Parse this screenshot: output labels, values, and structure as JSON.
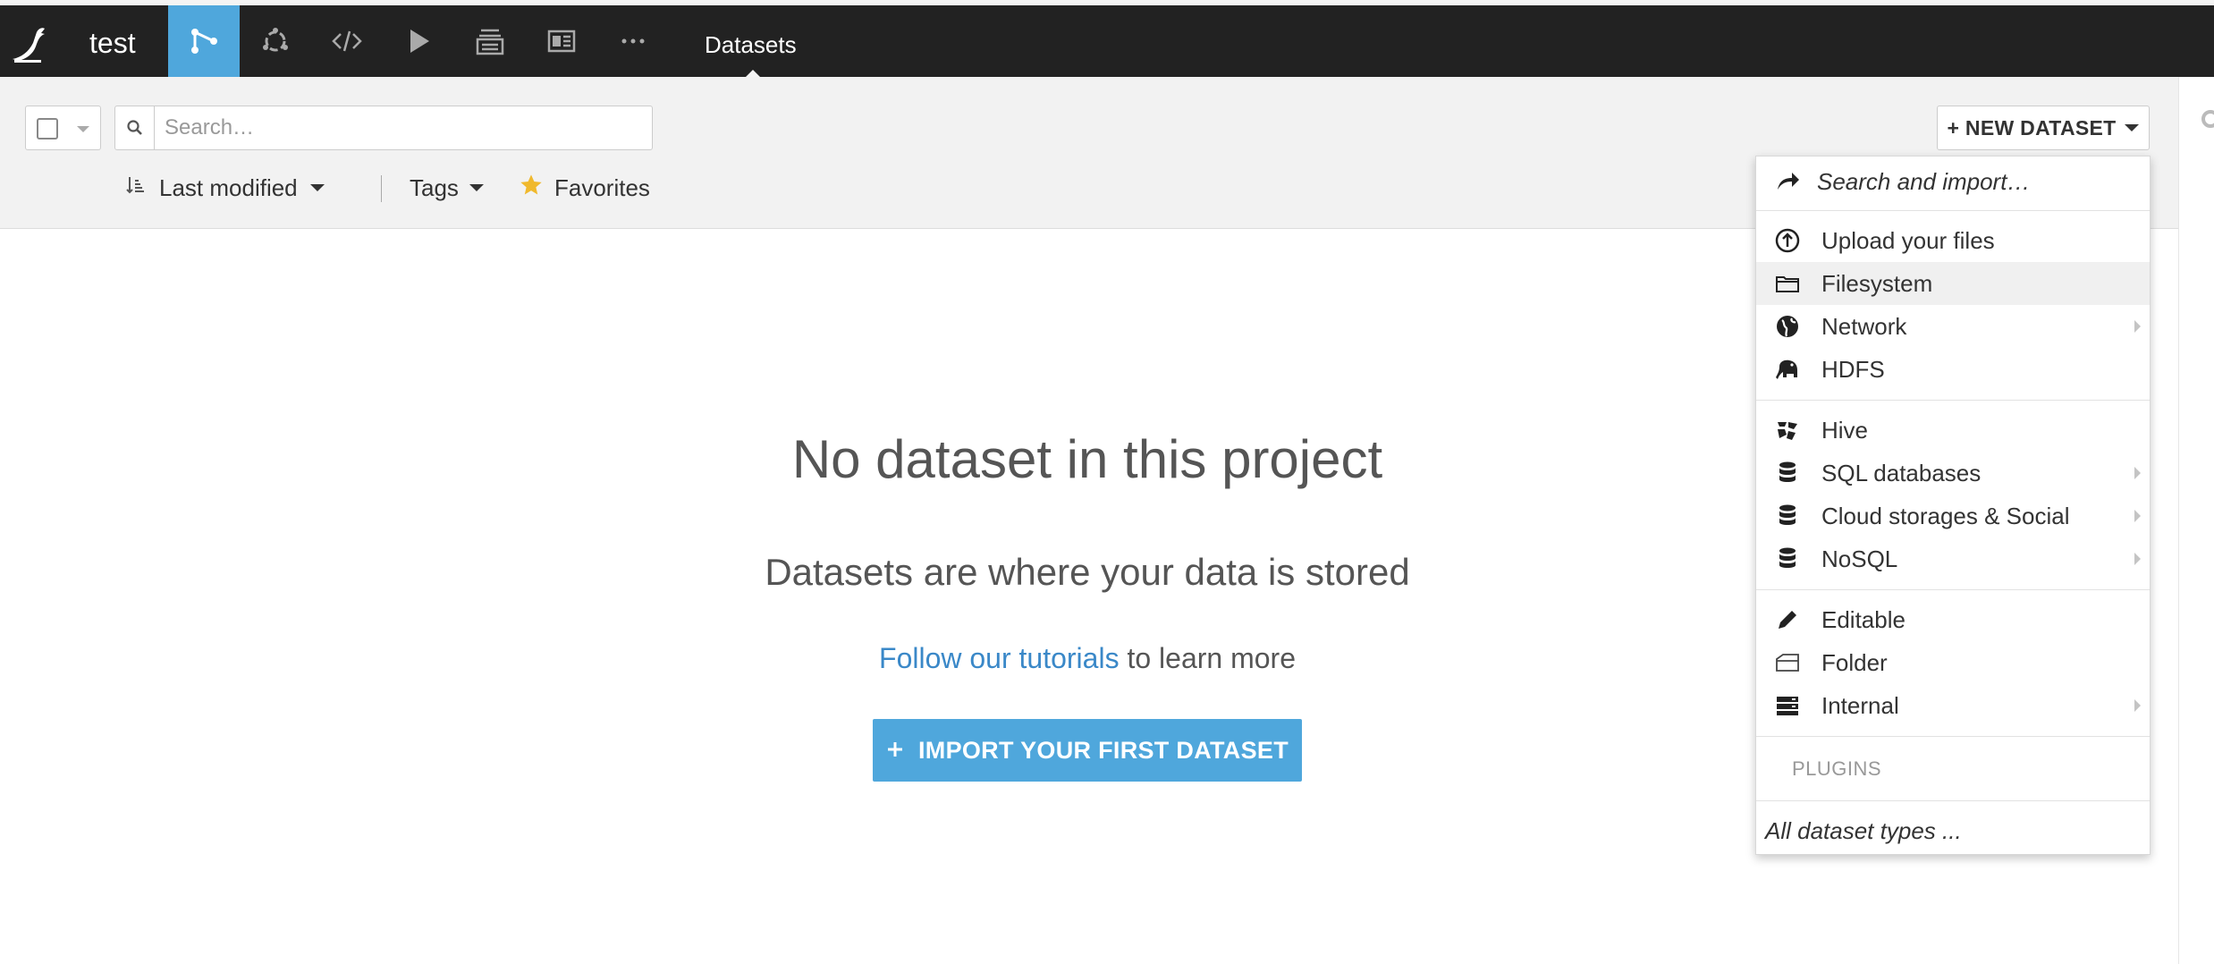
{
  "topbar": {
    "project_name": "test",
    "current_section": "Datasets",
    "nav_icons": [
      "flow-icon",
      "lab-icon",
      "code-icon",
      "run-icon",
      "deploy-icon",
      "dashboard-icon",
      "more-icon"
    ]
  },
  "toolbar": {
    "search_placeholder": "Search…",
    "sort_label": "Last modified",
    "tags_label": "Tags",
    "favorites_label": "Favorites",
    "new_dataset_label": "+ NEW DATASET"
  },
  "empty_state": {
    "title": "No dataset in this project",
    "subtitle": "Datasets are where your data is stored",
    "tutorial_link": "Follow our tutorials",
    "tutorial_rest": " to learn more",
    "import_button": "IMPORT YOUR FIRST DATASET"
  },
  "menu": {
    "search_import": "Search and import…",
    "upload": "Upload your files",
    "filesystem": "Filesystem",
    "network": "Network",
    "hdfs": "HDFS",
    "hive": "Hive",
    "sql": "SQL databases",
    "cloud": "Cloud storages & Social",
    "nosql": "NoSQL",
    "editable": "Editable",
    "folder": "Folder",
    "internal": "Internal",
    "plugins_title": "PLUGINS",
    "all_types": "All dataset types ..."
  },
  "colors": {
    "accent": "#4fa7dc",
    "topbar": "#222222",
    "link": "#3a88c8",
    "favorite_star": "#f0b92d"
  }
}
